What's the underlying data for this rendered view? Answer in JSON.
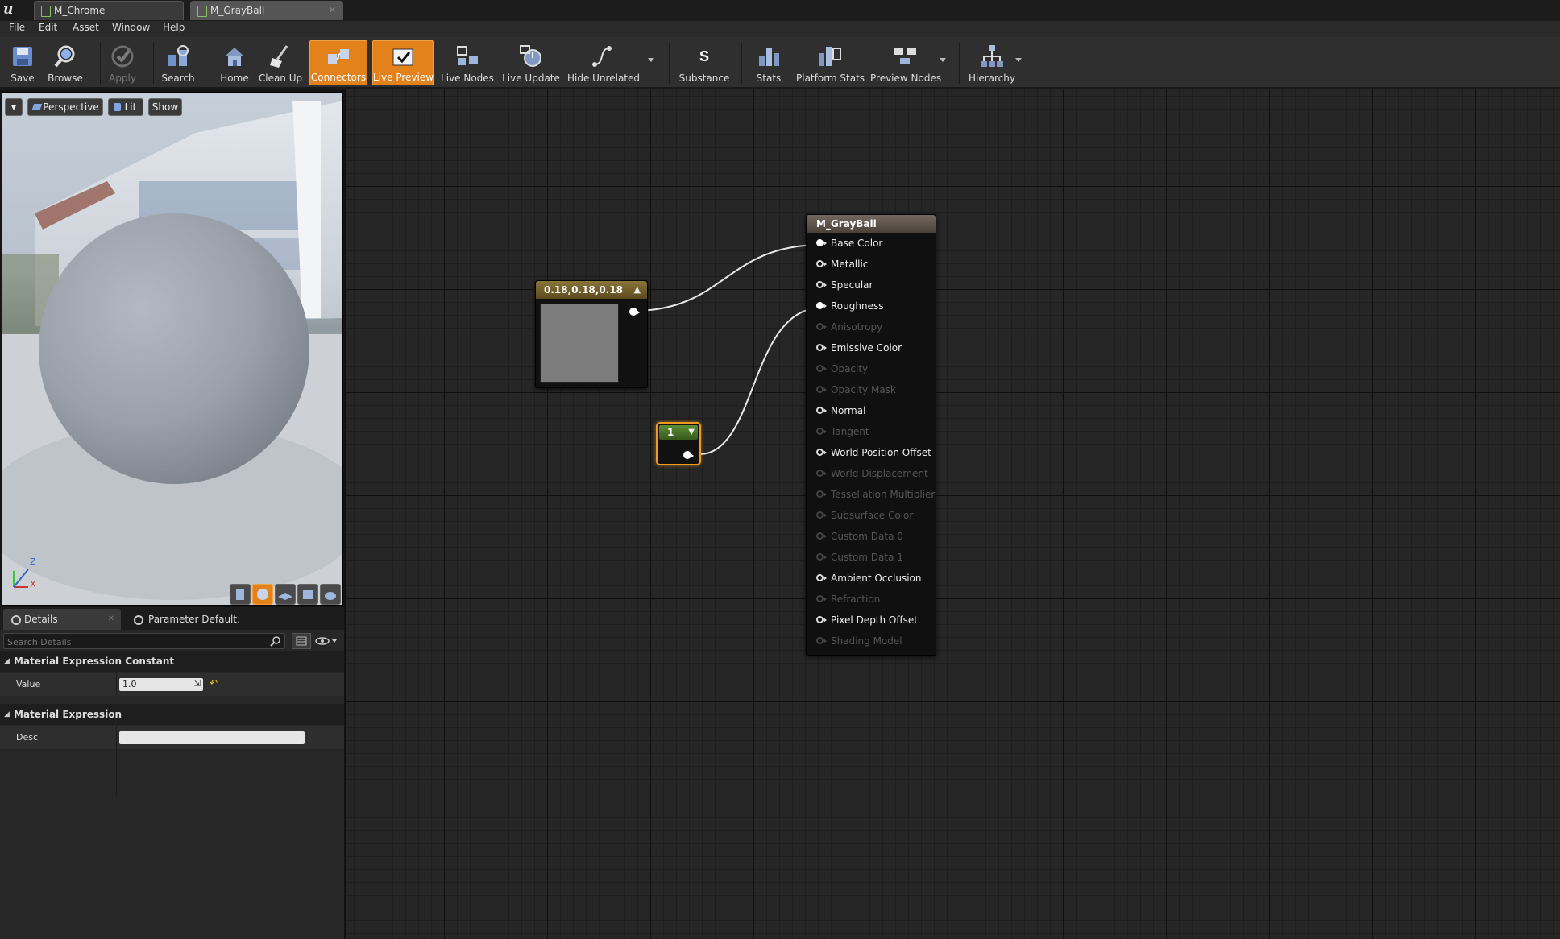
{
  "tabs": [
    {
      "label": "M_Chrome",
      "active": false
    },
    {
      "label": "M_GrayBall",
      "active": true
    }
  ],
  "menu": [
    "File",
    "Edit",
    "Asset",
    "Window",
    "Help"
  ],
  "toolbar": {
    "buttons": [
      {
        "label": "Save",
        "icon": "save-icon"
      },
      {
        "label": "Browse",
        "icon": "browse-icon"
      },
      {
        "label": "Apply",
        "icon": "apply-icon",
        "disabled": true
      },
      {
        "label": "Search",
        "icon": "search-icon"
      },
      {
        "label": "Home",
        "icon": "home-icon"
      },
      {
        "label": "Clean Up",
        "icon": "clean-up-icon"
      },
      {
        "label": "Connectors",
        "icon": "connectors-icon",
        "active": true
      },
      {
        "label": "Live Preview",
        "icon": "live-preview-icon",
        "active": true
      },
      {
        "label": "Live Nodes",
        "icon": "live-nodes-icon"
      },
      {
        "label": "Live Update",
        "icon": "live-update-icon"
      },
      {
        "label": "Hide Unrelated",
        "icon": "hide-unrelated-icon"
      },
      {
        "label": "Substance",
        "icon": "substance-icon"
      },
      {
        "label": "Stats",
        "icon": "stats-icon"
      },
      {
        "label": "Platform Stats",
        "icon": "platform-stats-icon"
      },
      {
        "label": "Preview Nodes",
        "icon": "preview-nodes-icon"
      },
      {
        "label": "Hierarchy",
        "icon": "hierarchy-icon"
      }
    ]
  },
  "viewport": {
    "perspective_label": "Perspective",
    "lit_label": "Lit",
    "show_label": "Show",
    "axis_z": "Z",
    "axis_x": "X"
  },
  "details": {
    "tab_details": "Details",
    "tab_params": "Parameter Default:",
    "search_placeholder": "Search Details",
    "section1": "Material Expression Constant",
    "value_label": "Value",
    "value": "1.0",
    "section2": "Material Expression",
    "desc_label": "Desc",
    "desc_value": ""
  },
  "graph": {
    "vector_node_title": "0.18,0.18,0.18",
    "swatch_color": "#7d7d7d",
    "scalar_node_value": "1",
    "material_node_title": "M_GrayBall",
    "pins": [
      {
        "label": "Base Color",
        "enabled": true,
        "connected": true
      },
      {
        "label": "Metallic",
        "enabled": true,
        "connected": false
      },
      {
        "label": "Specular",
        "enabled": true,
        "connected": false
      },
      {
        "label": "Roughness",
        "enabled": true,
        "connected": true
      },
      {
        "label": "Anisotropy",
        "enabled": false,
        "connected": false
      },
      {
        "label": "Emissive Color",
        "enabled": true,
        "connected": false
      },
      {
        "label": "Opacity",
        "enabled": false,
        "connected": false
      },
      {
        "label": "Opacity Mask",
        "enabled": false,
        "connected": false
      },
      {
        "label": "Normal",
        "enabled": true,
        "connected": false
      },
      {
        "label": "Tangent",
        "enabled": false,
        "connected": false
      },
      {
        "label": "World Position Offset",
        "enabled": true,
        "connected": false
      },
      {
        "label": "World Displacement",
        "enabled": false,
        "connected": false
      },
      {
        "label": "Tessellation Multiplier",
        "enabled": false,
        "connected": false
      },
      {
        "label": "Subsurface Color",
        "enabled": false,
        "connected": false
      },
      {
        "label": "Custom Data 0",
        "enabled": false,
        "connected": false
      },
      {
        "label": "Custom Data 1",
        "enabled": false,
        "connected": false
      },
      {
        "label": "Ambient Occlusion",
        "enabled": true,
        "connected": false
      },
      {
        "label": "Refraction",
        "enabled": false,
        "connected": false
      },
      {
        "label": "Pixel Depth Offset",
        "enabled": true,
        "connected": false
      },
      {
        "label": "Shading Model",
        "enabled": false,
        "connected": false
      }
    ]
  },
  "colors": {
    "accent_orange": "#e3821a",
    "vector_node_header": "#6e5a2a",
    "scalar_node_header": "#4a7a2a",
    "material_node_header": "#5a5148"
  }
}
